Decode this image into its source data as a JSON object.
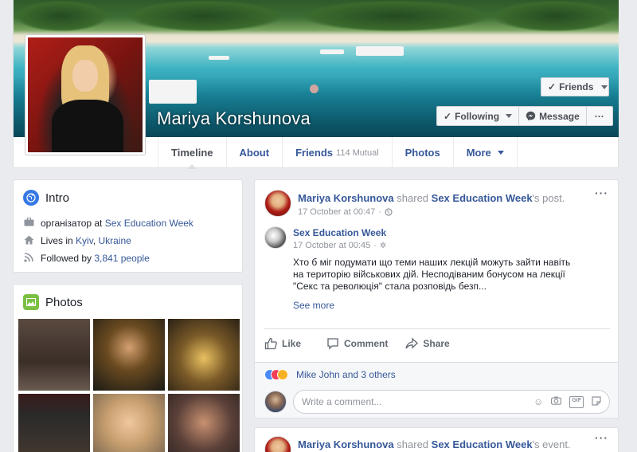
{
  "profile": {
    "name": "Mariya Korshunova",
    "friends_button": "Friends",
    "following_button": "Following",
    "message_button": "Message",
    "more_button": "···"
  },
  "tabs": [
    {
      "label": "Timeline"
    },
    {
      "label": "About"
    },
    {
      "label": "Friends",
      "sub": "114 Mutual"
    },
    {
      "label": "Photos"
    },
    {
      "label": "More"
    }
  ],
  "intro": {
    "title": "Intro",
    "work_prefix": "організатор at",
    "work_link": "Sex Education Week",
    "lives_prefix": "Lives in",
    "city": "Kyiv",
    "country": "Ukraine",
    "followed_prefix": "Followed by",
    "followers": "3,841 people"
  },
  "photos": {
    "title": "Photos"
  },
  "post": {
    "author": "Mariya Korshunova",
    "shared_word": "shared",
    "source": "Sex Education Week",
    "suffix": "'s post.",
    "time": "17 October at 00:47",
    "inner_author": "Sex Education Week",
    "inner_time": "17 October at 00:45",
    "text": "Хто б міг подумати що теми наших лекцій можуть зайти навіть на територію військових дій. Несподіваним бонусом на лекції \"Секс та революція\" стала розповідь безп...",
    "see_more": "See more",
    "like": "Like",
    "comment": "Comment",
    "share": "Share",
    "reactions": "Mike John and 3 others",
    "comment_placeholder": "Write a comment...",
    "menu": "···"
  },
  "post2": {
    "author": "Mariya Korshunova",
    "shared_word": "shared",
    "source": "Sex Education Week",
    "suffix": "'s event.",
    "menu": "···"
  },
  "colors": {
    "link": "#365899",
    "intro_icon": "#3578e5",
    "photos_icon": "#7bc043"
  }
}
